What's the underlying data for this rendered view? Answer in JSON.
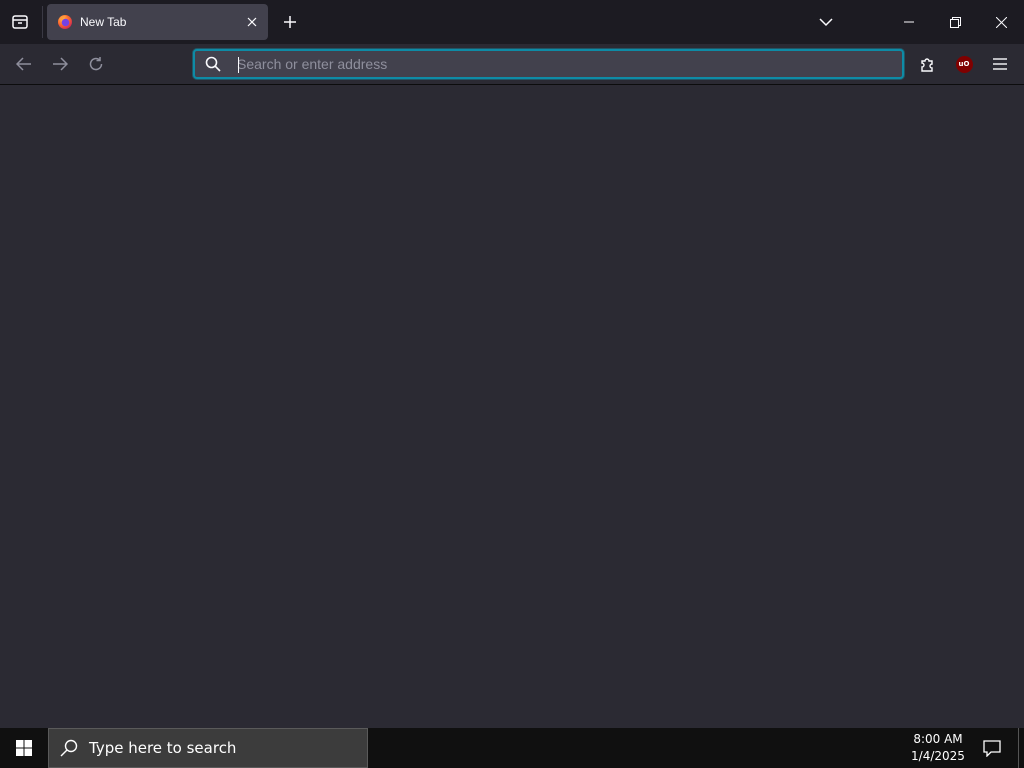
{
  "browser": {
    "tab": {
      "title": "New Tab",
      "favicon": "firefox-icon"
    },
    "urlbar": {
      "placeholder": "Search or enter address",
      "value": ""
    },
    "accent_color": "#00ddff",
    "extensions": [
      {
        "name": "ublock-origin-icon",
        "badge": "uO"
      }
    ]
  },
  "taskbar": {
    "search_placeholder": "Type here to search",
    "time": "8:00 AM",
    "date": "1/4/2025"
  }
}
